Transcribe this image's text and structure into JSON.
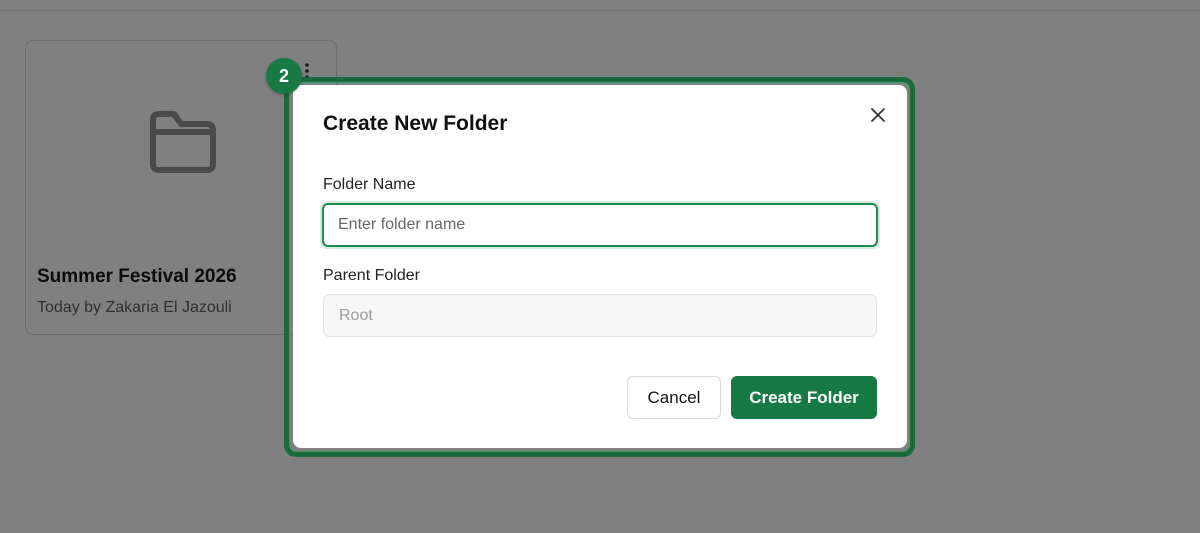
{
  "folder_card": {
    "title": "Summer Festival 2026",
    "meta": "Today by Zakaria El Jazouli",
    "icon": "folder-icon",
    "menu_icon": "kebab-menu-icon"
  },
  "tour": {
    "step_number": "2",
    "highlight_color": "#1a6b3a",
    "badge_color": "#177a44"
  },
  "dialog": {
    "title": "Create New Folder",
    "close_icon": "close-icon",
    "folder_name": {
      "label": "Folder Name",
      "placeholder": "Enter folder name",
      "value": ""
    },
    "parent_folder": {
      "label": "Parent Folder",
      "value": "Root"
    },
    "cancel_label": "Cancel",
    "create_label": "Create Folder"
  },
  "colors": {
    "overlay": "#808080",
    "primary": "#177a44",
    "dialog_bg": "#ffffff"
  }
}
